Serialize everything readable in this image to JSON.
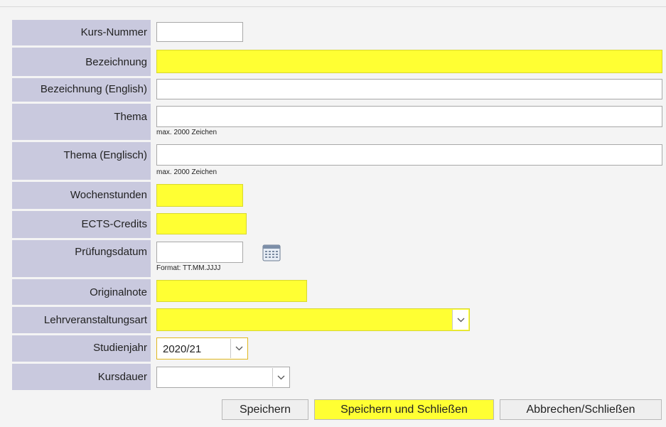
{
  "form": {
    "kurs_nummer": {
      "label": "Kurs-Nummer",
      "value": ""
    },
    "bezeichnung": {
      "label": "Bezeichnung",
      "value": ""
    },
    "bezeichnung_en": {
      "label": "Bezeichnung (English)",
      "value": ""
    },
    "thema": {
      "label": "Thema",
      "value": "",
      "hint": "max. 2000 Zeichen"
    },
    "thema_en": {
      "label": "Thema (Englisch)",
      "value": "",
      "hint": "max. 2000 Zeichen"
    },
    "wochenstunden": {
      "label": "Wochenstunden",
      "value": ""
    },
    "ects": {
      "label": "ECTS-Credits",
      "value": ""
    },
    "pruefungsdatum": {
      "label": "Prüfungsdatum",
      "value": "",
      "hint": "Format: TT.MM.JJJJ",
      "icon": "calendar-icon"
    },
    "originalnote": {
      "label": "Originalnote",
      "value": ""
    },
    "lehrveranstaltungsart": {
      "label": "Lehrveranstaltungsart",
      "value": "",
      "icon": "chevron-down-icon"
    },
    "studienjahr": {
      "label": "Studienjahr",
      "value": "2020/21",
      "icon": "chevron-down-icon"
    },
    "kursdauer": {
      "label": "Kursdauer",
      "value": "",
      "icon": "chevron-down-icon"
    }
  },
  "buttons": {
    "save": "Speichern",
    "save_close": "Speichern und Schließen",
    "cancel_close": "Abbrechen/Schließen"
  },
  "colors": {
    "label_bg": "#c9c9de",
    "page_bg": "#f4f4f4",
    "highlight": "#ffff33"
  }
}
